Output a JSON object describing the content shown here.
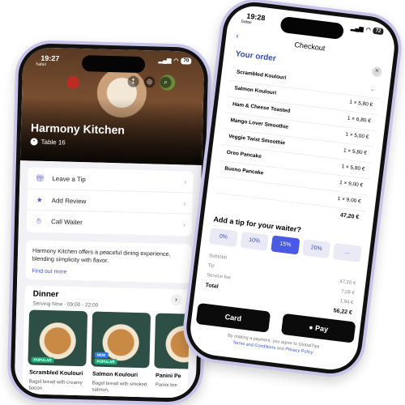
{
  "left_phone": {
    "status": {
      "time": "19:27",
      "carrier": "Safari",
      "battery": "70"
    },
    "restaurant_name": "Harmony Kitchen",
    "table": "Table 16",
    "actions": [
      {
        "label": "Leave a Tip",
        "icon": "gift-icon"
      },
      {
        "label": "Add Review",
        "icon": "star-icon"
      },
      {
        "label": "Call Waiter",
        "icon": "waving-hand-icon"
      }
    ],
    "about": {
      "text": "Harmony Kitchen offers a peaceful dining experience, blending simplicity with flavor.",
      "link": "Find out more"
    },
    "menu_section": {
      "title": "Dinner",
      "subtitle": "Serving Now - 09:00 - 22:00",
      "dishes": [
        {
          "name": "Scrambled Koulouri",
          "desc": "Bagel bread with creamy bacon",
          "badge": "POPULAR"
        },
        {
          "name": "Salmon Koulouri",
          "desc": "Bagel bread with smoked salmon,",
          "badge": "POPULAR",
          "badge2": "NEW"
        },
        {
          "name": "Panini Pe",
          "desc": "Panini bre"
        }
      ]
    }
  },
  "right_phone": {
    "status": {
      "time": "19:28",
      "carrier": "Safari",
      "battery": "72"
    },
    "title": "Checkout",
    "order_title": "Your order",
    "items": [
      {
        "name": "Scrambled Koulouri",
        "price": ""
      },
      {
        "name": "Salmon Koulouri",
        "price": "1 × 5,80 €"
      },
      {
        "name": "Ham & Cheese Toasted",
        "price": "1 × 6,80 €"
      },
      {
        "name": "Mango Lover Smoothie",
        "price": "1 × 5,00 €"
      },
      {
        "name": "Veggie Twist Smoothie",
        "price": "1 × 5,80 €"
      },
      {
        "name": "Oreo Pancake",
        "price": "1 × 5,80 €"
      },
      {
        "name": "Bueno Pancake",
        "price": "1 × 9,00 €"
      },
      {
        "name": "",
        "price": "1 × 9,00 €"
      }
    ],
    "order_total": "47,20 €",
    "tip_title": "Add a tip for your waiter?",
    "tip_options": [
      "0%",
      "10%",
      "15%",
      "20%",
      "..."
    ],
    "summary": [
      {
        "label": "Subtotal",
        "value": ""
      },
      {
        "label": "Tip",
        "value": "47,20 €"
      },
      {
        "label": "Service fee",
        "value": "7,08 €"
      },
      {
        "label": "Total",
        "value": "1,94 €"
      },
      {
        "label": "",
        "value": "56,22 €"
      }
    ],
    "pay_card": "Card",
    "pay_apple": "Pay",
    "legal_prefix": "By making a payment, you agree to GlobalTips",
    "legal_terms": "Terms and Conditions",
    "legal_and": "and",
    "legal_privacy": "Privacy Policy"
  }
}
